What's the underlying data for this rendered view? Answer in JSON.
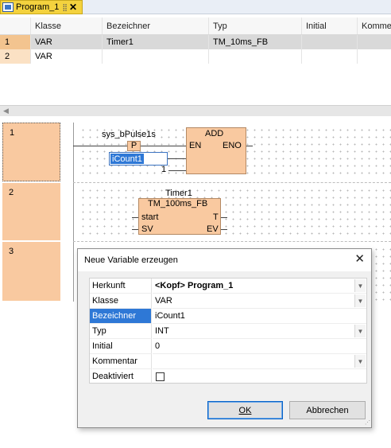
{
  "editor_tab": {
    "title": "Program_1"
  },
  "declarations": {
    "columns": [
      "Klasse",
      "Bezeichner",
      "Typ",
      "Initial",
      "Komme"
    ],
    "rows": [
      {
        "index": "1",
        "klasse": "VAR",
        "bezeichner": "Timer1",
        "typ": "TM_10ms_FB",
        "initial": "",
        "kommentar": ""
      },
      {
        "index": "2",
        "klasse": "VAR",
        "bezeichner": "",
        "typ": "",
        "initial": "",
        "kommentar": ""
      }
    ]
  },
  "networks": [
    {
      "number": "1"
    },
    {
      "number": "2"
    },
    {
      "number": "3"
    }
  ],
  "network1": {
    "pulse_var": "sys_bPulse1s",
    "contact_label": "P",
    "edit_value": "iCount1",
    "constant": "1",
    "block_name": "ADD",
    "en_label": "EN",
    "eno_label": "ENO"
  },
  "network2": {
    "instance": "Timer1",
    "block_type": "TM_100ms_FB",
    "start_label": "start",
    "t_label": "T",
    "sv_label": "SV",
    "ev_label": "EV"
  },
  "dialog": {
    "title": "Neue Variable erzeugen",
    "properties": [
      {
        "label": "Herkunft",
        "value": "<Kopf> Program_1"
      },
      {
        "label": "Klasse",
        "value": "VAR"
      },
      {
        "label": "Bezeichner",
        "value": "iCount1"
      },
      {
        "label": "Typ",
        "value": "INT"
      },
      {
        "label": "Initial",
        "value": "0"
      },
      {
        "label": "Kommentar",
        "value": ""
      },
      {
        "label": "Deaktiviert",
        "value": ""
      }
    ],
    "ok_label": "OK",
    "cancel_label": "Abbrechen"
  }
}
